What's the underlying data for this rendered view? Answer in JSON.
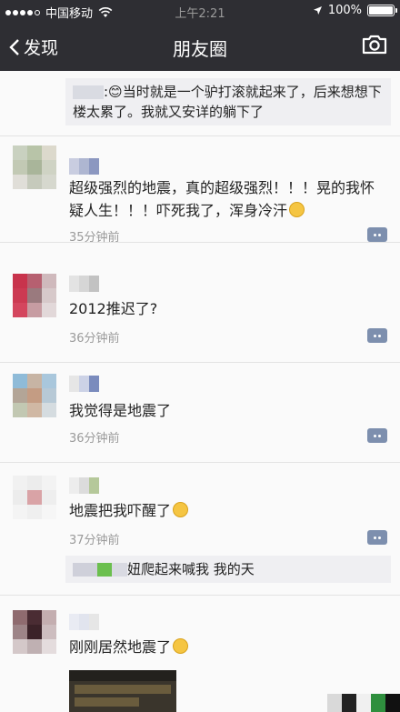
{
  "status_bar": {
    "carrier": "中国移动",
    "time": "上午2:21",
    "battery": "100%"
  },
  "nav": {
    "back_label": "发现",
    "title": "朋友圈"
  },
  "top_comment": {
    "text": ":😊当时就是一个驴打滚就起来了，后来想想下楼太累了。我就又安详的躺下了"
  },
  "posts": [
    {
      "text": "超级强烈的地震，真的超级强烈！！！晃的我怀疑人生！！！吓死我了，浑身冷汗",
      "time": "35分钟前"
    },
    {
      "text": "2012推迟了?",
      "time": "36分钟前"
    },
    {
      "text": "我觉得是地震了",
      "time": "36分钟前"
    },
    {
      "text": "地震把我吓醒了",
      "time": "37分钟前",
      "comment": "妞爬起来喊我 我的天"
    },
    {
      "text": "刚刚居然地震了"
    }
  ],
  "colors": {
    "header_bg": "#2e2e33",
    "comment_bg": "#efeff2",
    "time_text": "#9a9a9a",
    "more_button": "#7d8fae"
  }
}
